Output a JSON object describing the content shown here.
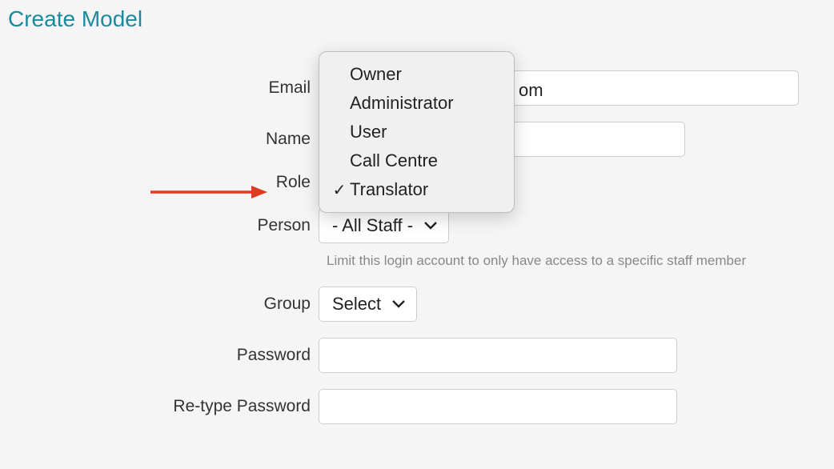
{
  "title": "Create Model",
  "labels": {
    "email": "Email",
    "name": "Name",
    "role": "Role",
    "person": "Person",
    "group": "Group",
    "password": "Password",
    "retype_password": "Re-type Password"
  },
  "email_visible_tail": "om",
  "person_select": "- All Staff -",
  "person_help": "Limit this login account to only have access to a specific staff member",
  "group_select": "Select",
  "role_dropdown": {
    "options": [
      {
        "label": "Owner",
        "selected": false
      },
      {
        "label": "Administrator",
        "selected": false
      },
      {
        "label": "User",
        "selected": false
      },
      {
        "label": "Call Centre",
        "selected": false
      },
      {
        "label": "Translator",
        "selected": true
      }
    ]
  }
}
